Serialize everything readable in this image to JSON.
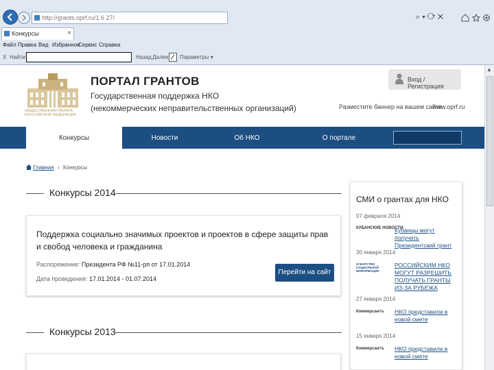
{
  "browser": {
    "url": "http://grants.oprf.ru/1 6 27/",
    "tab_label": "Конкурсы",
    "tab_close": "×",
    "address_tools": "⌕ ▾ ⟳ ✕",
    "menu": [
      "Файл",
      "Правка",
      "Вид",
      "Избранное",
      "Сервис",
      "Справка"
    ],
    "find_label": "Найти:",
    "find_value": "",
    "find_prev": "Назад",
    "find_next": "Далее",
    "find_options": "Параметры ▾",
    "close_find": "X"
  },
  "header": {
    "logo_text": "ОБЩЕСТВЕННАЯ ПАЛАТА РОССИЙСКОЙ ФЕДЕРАЦИИ",
    "title": "ПОРТАЛ ГРАНТОВ",
    "subtitle_1": "Государственная поддержка НКО",
    "subtitle_2": "(некоммерческих неправительственных организаций)",
    "login_label": "Вход / Регистрация",
    "banner_link": "Разместите баннер на вашем сайте",
    "site_url": "www.oprf.ru"
  },
  "nav": {
    "items": [
      "Конкурсы",
      "Новости",
      "Об НКО",
      "О портале"
    ],
    "search_value": ""
  },
  "breadcrumb": {
    "home": "Главная",
    "separator": "›",
    "current": "Конкурсы"
  },
  "sections": {
    "y2014": "Конкурсы 2014",
    "y2013": "Конкурсы 2013"
  },
  "card": {
    "title": "Поддержка социально значимых проектов и проектов в сфере защиты прав и свобод человека и гражданина",
    "order_label": "Распоряжение:",
    "order_value": "Президента РФ №11-рп от 17.01.2014",
    "dates_label": "Дата проведения:",
    "dates_value": "17.01.2014 - 01.07.2014",
    "button": "Перейти на сайт"
  },
  "sidebar": {
    "title": "СМИ о грантах для НКО",
    "news": [
      {
        "date": "07 февраля 2014",
        "source": "КУБАНСКИЕ НОВОСТИ",
        "text": "Кубанцы могут получить Президентский грант"
      },
      {
        "date": "30 января 2014",
        "source": "АГЕНТСТВО СОЦИАЛЬНОЙ ИНФОРМАЦИИ",
        "text": "РОССИЙСКИМ НКО МОГУТ РАЗРЕШИТЬ ПОЛУЧАТЬ ГРАНТЫ ИЗ-ЗА РУБЕЖА"
      },
      {
        "date": "27 января 2014",
        "source": "Коммерсантъ",
        "text": "НКО представили в новой смете"
      },
      {
        "date": "15 января 2014",
        "source": "Коммерсантъ",
        "text": "НКО представили в новой смете"
      }
    ]
  },
  "colors": {
    "nav_bg": "#1c4e82",
    "button_bg": "#1c4e82",
    "link": "#1c4e82",
    "logo_gold": "#b59a5e"
  }
}
